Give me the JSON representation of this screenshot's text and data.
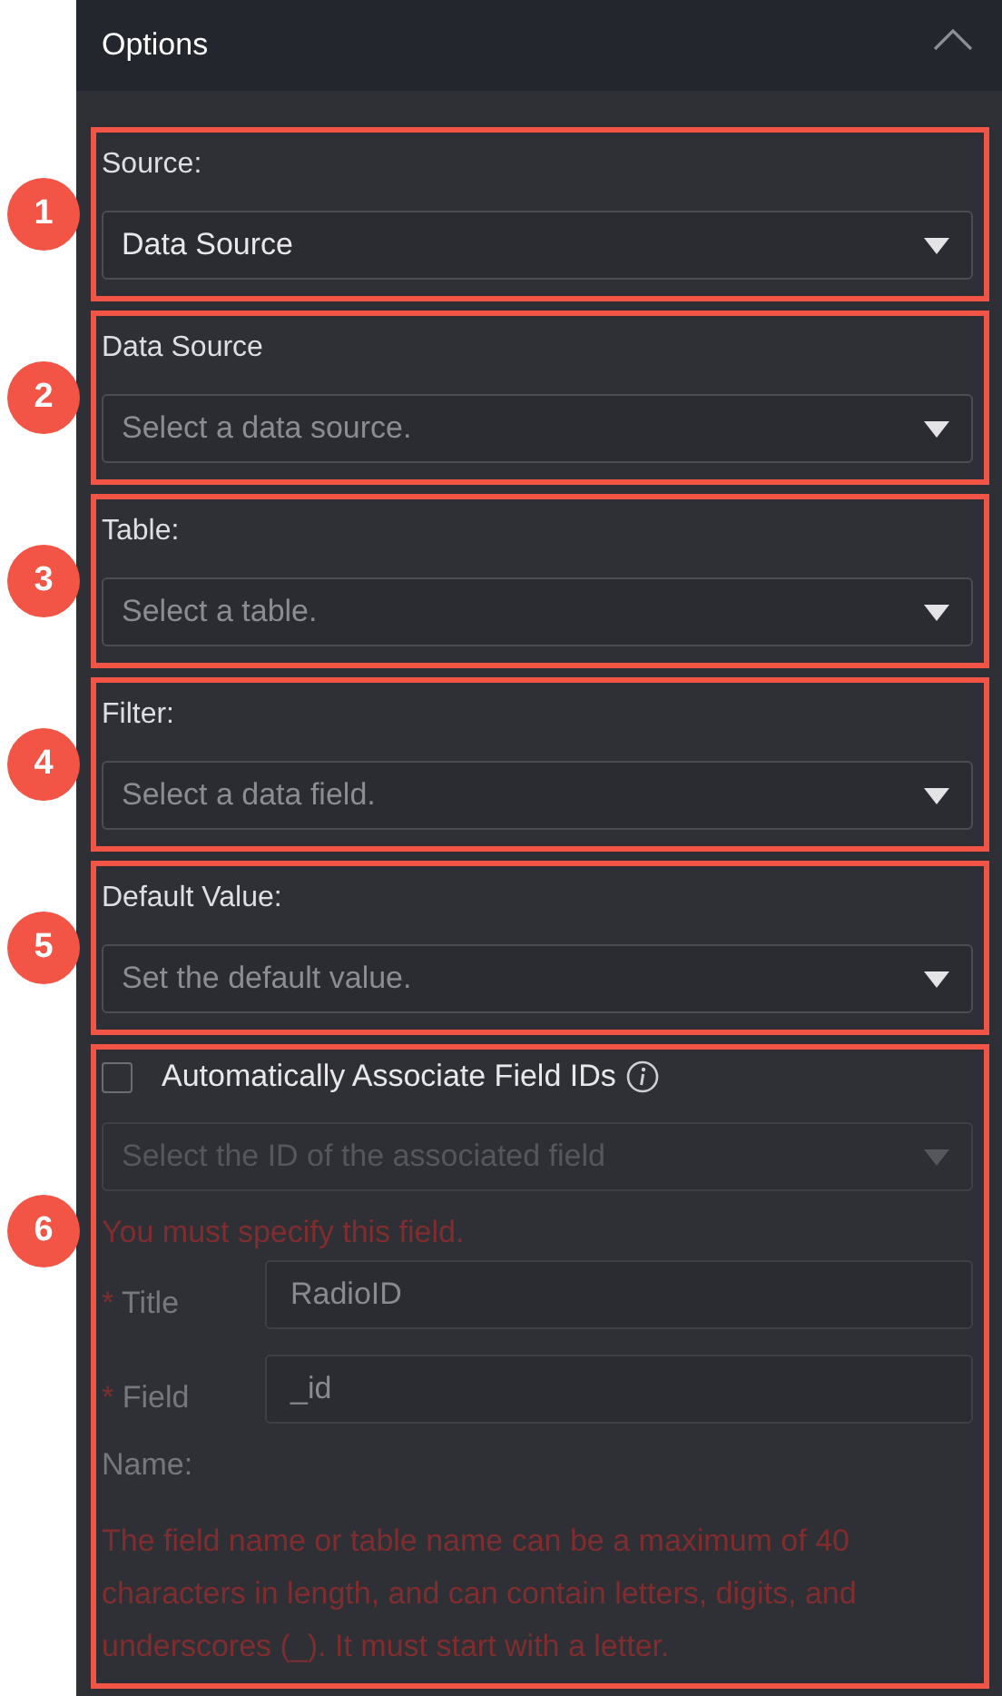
{
  "panel": {
    "title": "Options",
    "expanded": true
  },
  "sections": [
    {
      "kind": "select",
      "number": "1",
      "label": "Source:",
      "value": "Data Source"
    },
    {
      "kind": "select",
      "number": "2",
      "label": "Data Source",
      "placeholder": "Select a data source."
    },
    {
      "kind": "select",
      "number": "3",
      "label": "Table:",
      "placeholder": "Select a table."
    },
    {
      "kind": "select",
      "number": "4",
      "label": "Filter:",
      "placeholder": "Select a data field."
    },
    {
      "kind": "select",
      "number": "5",
      "label": "Default Value:",
      "placeholder": "Set the default value."
    },
    {
      "kind": "association",
      "number": "6",
      "checkbox": {
        "label": "Automatically Associate Field IDs",
        "checked": false
      },
      "select": {
        "placeholder": "Select the ID of the associated field",
        "disabled": true
      },
      "error": "You must specify this field.",
      "fields": [
        {
          "marker": "*",
          "label": "Title",
          "value": "RadioID",
          "disabled": true
        },
        {
          "marker": "*",
          "label": "Field",
          "value": "_id",
          "disabled": true
        }
      ],
      "name_label": "Name:",
      "note": "The field name or table name can be a maximum of 40 characters in length, and can contain letters, digits, and underscores (_). It must start with a letter."
    }
  ]
}
